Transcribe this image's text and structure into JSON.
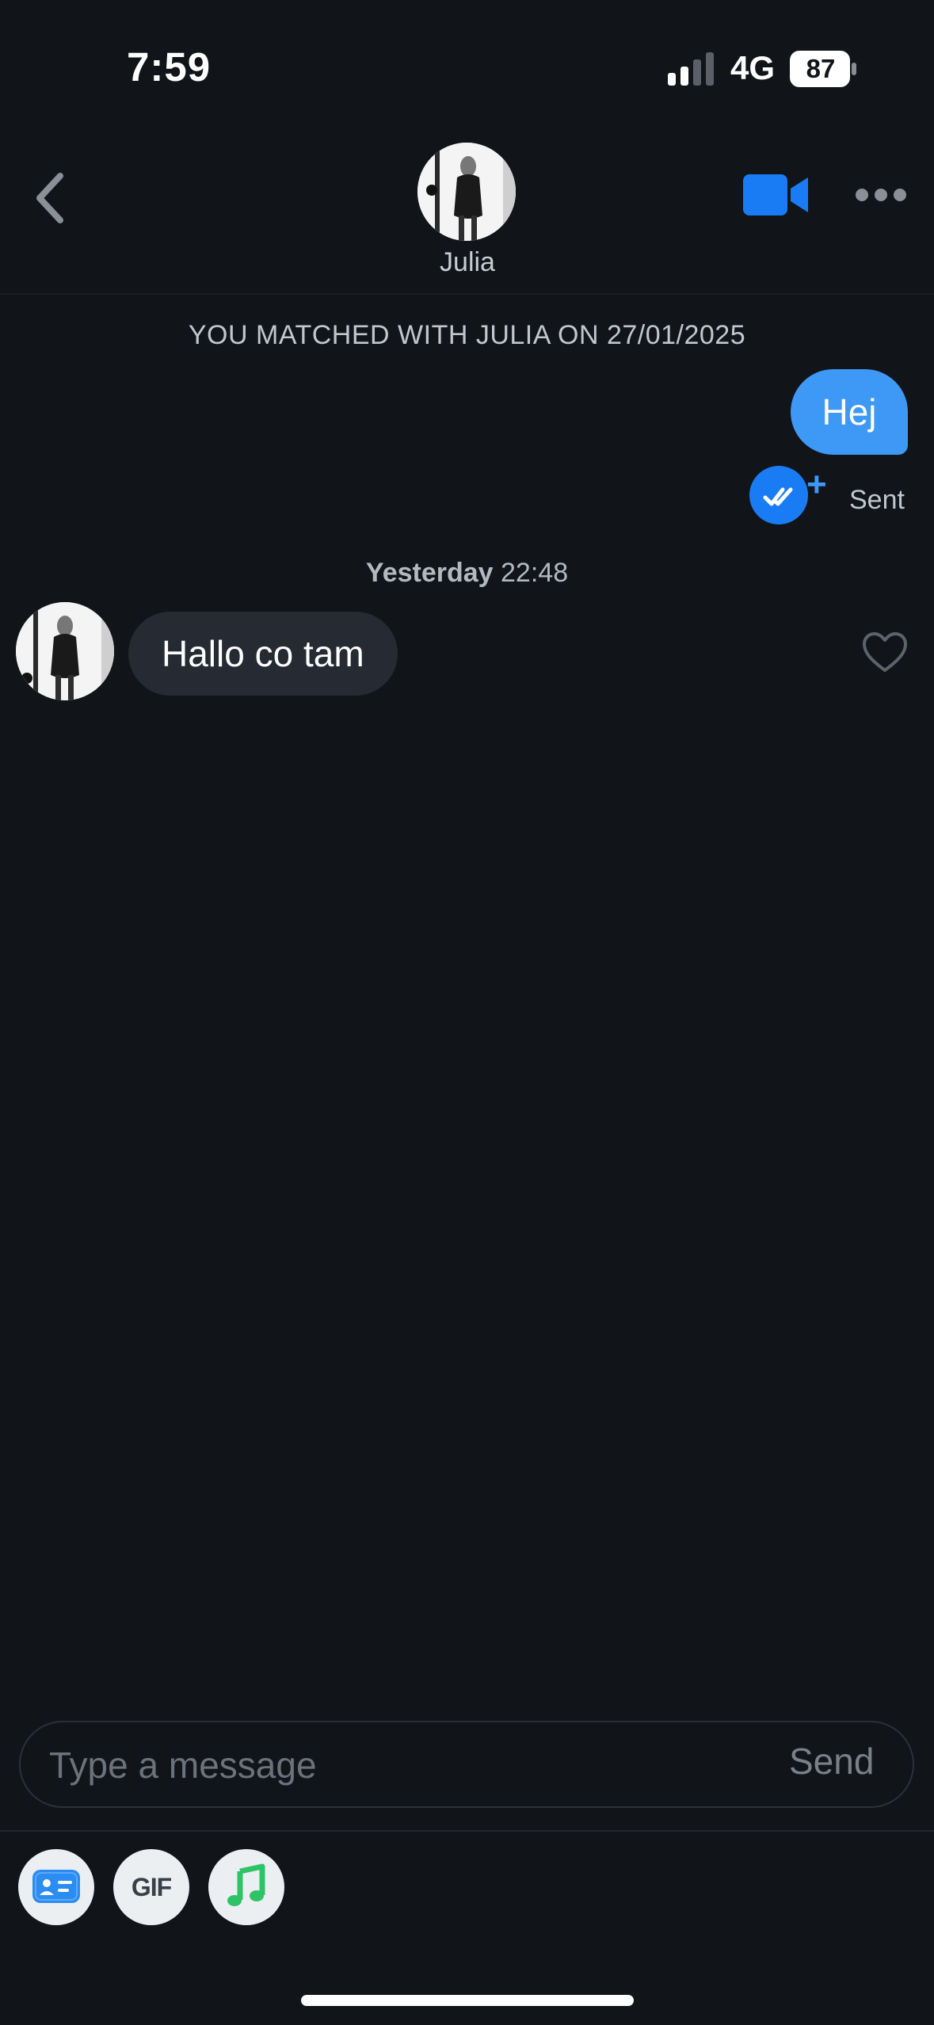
{
  "status_bar": {
    "time": "7:59",
    "network": "4G",
    "battery": "87"
  },
  "header": {
    "contact_name": "Julia",
    "back_icon": "chevron-left-icon",
    "video_icon": "video-camera-icon",
    "more_icon": "more-horizontal-icon",
    "accent_color": "#1a7cf5"
  },
  "chat": {
    "match_note": "YOU MATCHED WITH JULIA ON 27/01/2025",
    "outgoing_message": "Hej",
    "receipt_status": "Sent",
    "timestamp_day": "Yesterday",
    "timestamp_time": "22:48",
    "incoming_message": "Hallo co tam"
  },
  "composer": {
    "placeholder": "Type a message",
    "send_label": "Send"
  },
  "toolbar": {
    "gif_label": "GIF",
    "card_icon": "id-card-icon",
    "music_icon": "music-note-icon"
  }
}
